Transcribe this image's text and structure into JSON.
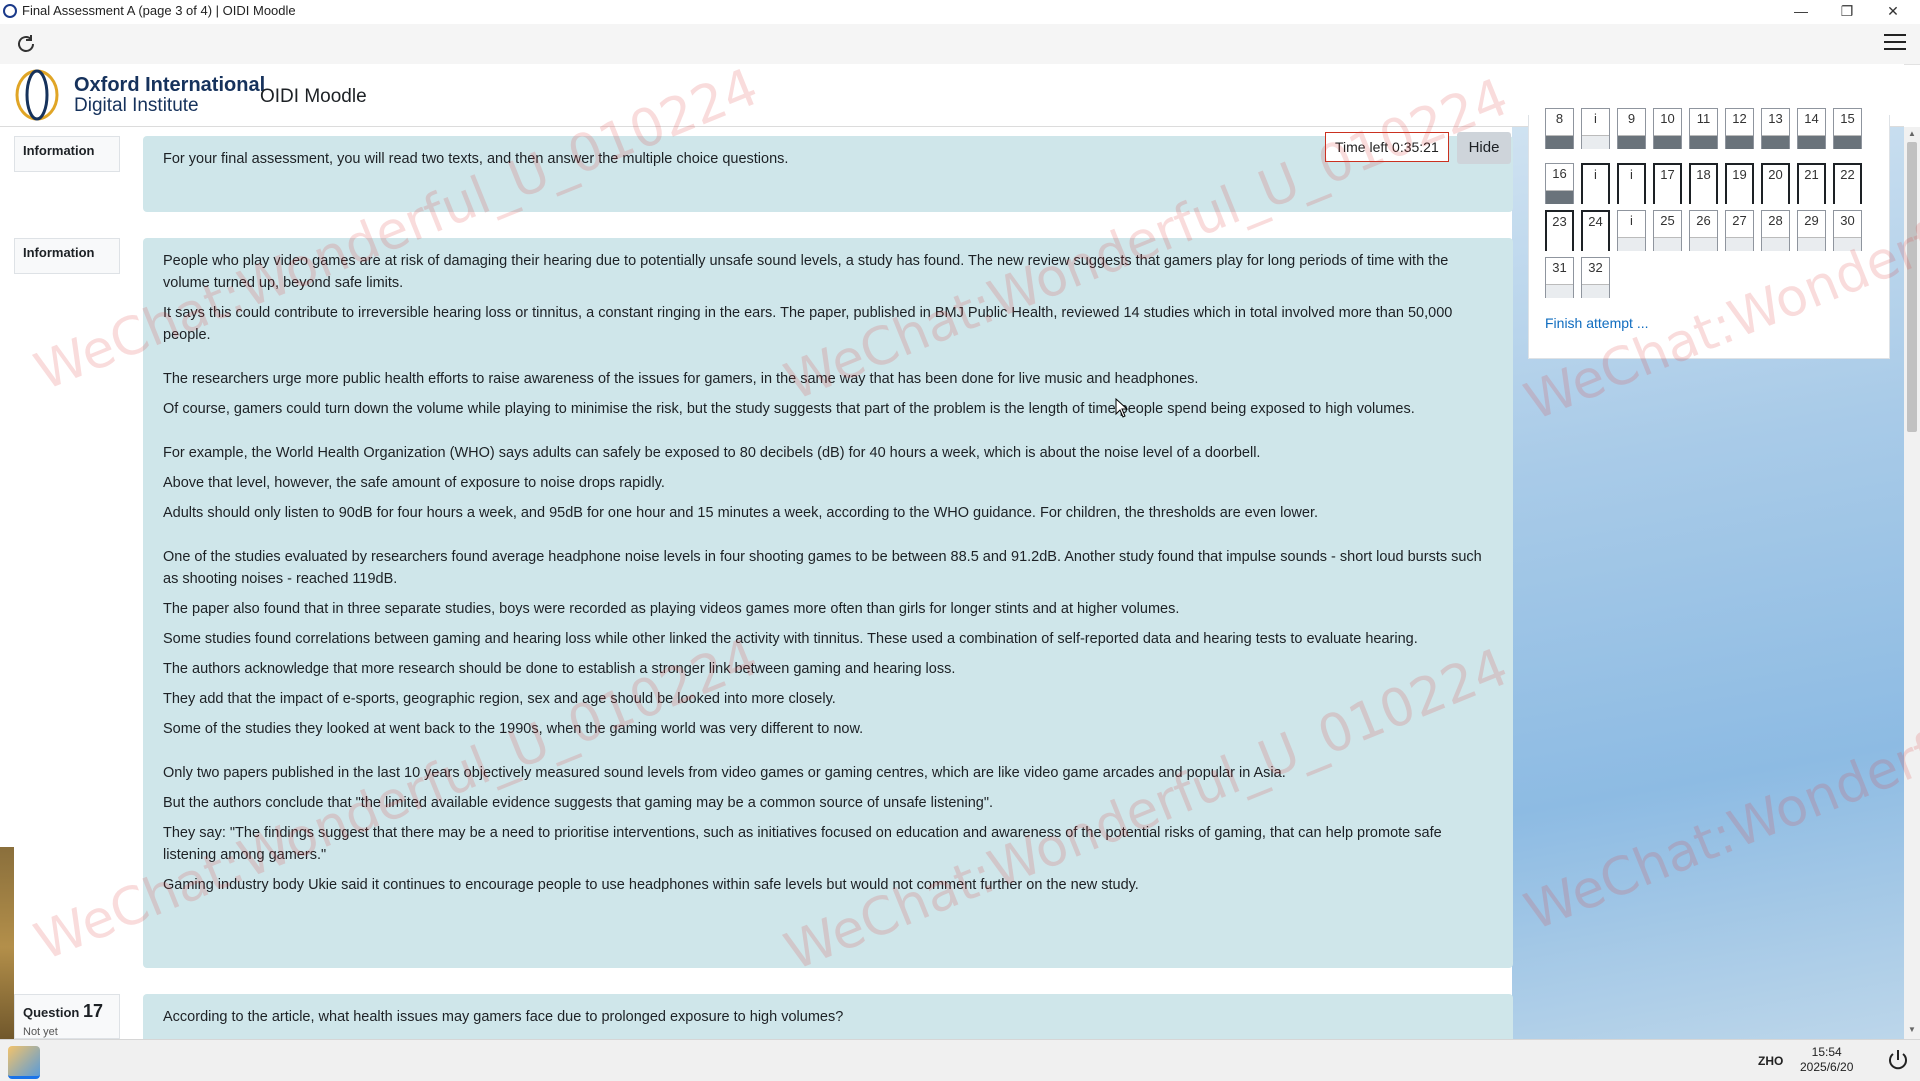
{
  "window": {
    "title": "Final Assessment A (page 3 of 4) | OIDI Moodle",
    "controls": [
      "minimize",
      "restore",
      "close"
    ]
  },
  "header": {
    "logo_line1": "Oxford International",
    "logo_line2": "Digital Institute",
    "site_name": "OIDI Moodle"
  },
  "timer": {
    "label": "Time left 0:35:21",
    "hide_label": "Hide"
  },
  "blocks": [
    {
      "label": "Information",
      "paragraphs": [
        "For your final assessment, you will read two texts, and then answer the multiple choice questions."
      ]
    },
    {
      "label": "Information",
      "paragraphs": [
        "People who play video games are at risk of damaging their hearing due to potentially unsafe sound levels, a study has found. The new review suggests that gamers play for long periods of time with the volume turned up, beyond safe limits.",
        "It says this could contribute to irreversible hearing loss or tinnitus, a constant ringing in the ears. The paper, published in BMJ Public Health, reviewed 14 studies which in total involved more than 50,000 people.",
        "The researchers urge more public health efforts to raise awareness of the issues for gamers, in the same way that has been done for live music and headphones.",
        "Of course, gamers could turn down the volume while playing to minimise the risk, but the study suggests that part of the problem is the length of time people spend being exposed to high volumes.",
        "For example, the World Health Organization (WHO) says adults can safely be exposed to 80 decibels (dB) for 40 hours a week, which is about the noise level of a doorbell.",
        "Above that level, however, the safe amount of exposure to noise drops rapidly.",
        "Adults should only listen to 90dB for four hours a week, and 95dB for one hour and 15 minutes a week, according to the WHO guidance. For children, the thresholds are even lower.",
        "One of the studies evaluated by researchers found average headphone noise levels in four shooting games to be between 88.5 and 91.2dB. Another study found that impulse sounds - short loud bursts such as shooting noises - reached 119dB.",
        "The paper also found that in three separate studies, boys were recorded as playing videos games more often than girls for longer stints and at higher volumes.",
        "Some studies found correlations between gaming and hearing loss while other linked the activity with tinnitus. These used a combination of self-reported data and hearing tests to evaluate hearing.",
        "The authors acknowledge that more research should be done to establish a stronger link between gaming and hearing loss.",
        "They add that the impact of e-sports, geographic region, sex and age should be looked into more closely.",
        "Some of the studies they looked at went back to the 1990s, when the gaming world was very different to now.",
        "Only two papers published in the last 10 years objectively measured sound levels from video games or gaming centres, which are like video game arcades and popular in Asia.",
        "But the authors conclude that \"the limited available evidence suggests that gaming may be a common source of unsafe listening\".",
        "They say: \"The findings suggest that there may be a need to prioritise interventions, such as initiatives focused on education and awareness of the potential risks of gaming, that can help promote safe listening among gamers.\"",
        "Gaming industry body Ukie said it continues to encourage people to use headphones within safe levels but would not comment further on the new study."
      ]
    }
  ],
  "question": {
    "prefix": "Question",
    "number": "17",
    "state": "Not yet",
    "text": "According to the article, what health issues may gamers face due to prolonged exposure to high volumes?"
  },
  "quiz_nav": {
    "rows": [
      [
        {
          "n": "8",
          "s": "answered"
        },
        {
          "n": "i",
          "s": "info"
        },
        {
          "n": "9",
          "s": "answered"
        },
        {
          "n": "10",
          "s": "answered"
        },
        {
          "n": "11",
          "s": "answered"
        },
        {
          "n": "12",
          "s": "answered"
        },
        {
          "n": "13",
          "s": "answered"
        },
        {
          "n": "14",
          "s": "answered"
        },
        {
          "n": "15",
          "s": "answered"
        }
      ],
      [
        {
          "n": "16",
          "s": "answered"
        },
        {
          "n": "i",
          "s": "current"
        },
        {
          "n": "i",
          "s": "current"
        },
        {
          "n": "17",
          "s": "current"
        },
        {
          "n": "18",
          "s": "current"
        },
        {
          "n": "19",
          "s": "current"
        },
        {
          "n": "20",
          "s": "current"
        },
        {
          "n": "21",
          "s": "current"
        },
        {
          "n": "22",
          "s": "flagged"
        }
      ],
      [
        {
          "n": "23",
          "s": "current"
        },
        {
          "n": "24",
          "s": "current"
        },
        {
          "n": "i",
          "s": "info"
        },
        {
          "n": "25",
          "s": "notyet"
        },
        {
          "n": "26",
          "s": "notyet"
        },
        {
          "n": "27",
          "s": "notyet"
        },
        {
          "n": "28",
          "s": "notyet"
        },
        {
          "n": "29",
          "s": "notyet"
        },
        {
          "n": "30",
          "s": "notyet"
        }
      ],
      [
        {
          "n": "31",
          "s": "notyet"
        },
        {
          "n": "32",
          "s": "notyet"
        }
      ]
    ],
    "finish_label": "Finish attempt ..."
  },
  "taskbar": {
    "language": "ZHO",
    "time": "15:54",
    "date": "2025/6/20"
  },
  "watermark": "WeChat:Wonderful_U_010224",
  "colors": {
    "content_bg": "#cfe6ea",
    "accent_link": "#0f6cbf",
    "timer_border": "#ca3120"
  }
}
